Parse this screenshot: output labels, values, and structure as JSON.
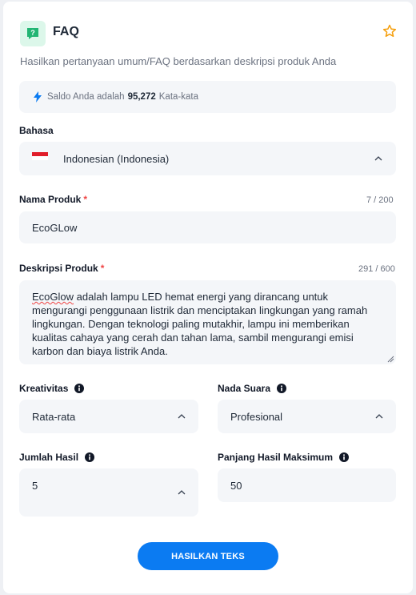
{
  "header": {
    "title": "FAQ",
    "subtitle": "Hasilkan pertanyaan umum/FAQ berdasarkan deskripsi produk Anda"
  },
  "balance": {
    "prefix": "Saldo Anda adalah",
    "amount": "95,272",
    "suffix": "Kata-kata"
  },
  "language": {
    "label": "Bahasa",
    "value": "Indonesian (Indonesia)"
  },
  "product_name": {
    "label": "Nama Produk",
    "required": "*",
    "counter": "7 / 200",
    "value": "EcoGLow"
  },
  "description": {
    "label": "Deskripsi Produk",
    "required": "*",
    "counter": "291 / 600",
    "first_word": "EcoGlow",
    "value": " adalah lampu LED hemat energi yang dirancang untuk mengurangi penggunaan listrik dan menciptakan lingkungan yang ramah lingkungan. Dengan teknologi paling mutakhir, lampu ini memberikan kualitas cahaya yang cerah dan tahan lama, sambil mengurangi emisi karbon dan biaya listrik Anda."
  },
  "creativity": {
    "label": "Kreativitas",
    "value": "Rata-rata"
  },
  "tone": {
    "label": "Nada Suara",
    "value": "Profesional"
  },
  "result_count": {
    "label": "Jumlah Hasil",
    "value": "5"
  },
  "max_length": {
    "label": "Panjang Hasil Maksimum",
    "value": "50"
  },
  "submit": {
    "label": "HASILKAN TEKS"
  },
  "colors": {
    "accent": "#0b7bf2",
    "required": "#ef4444",
    "icon_bg": "#dcf7ea",
    "icon_fg": "#22b573",
    "star": "#f59e0b"
  }
}
